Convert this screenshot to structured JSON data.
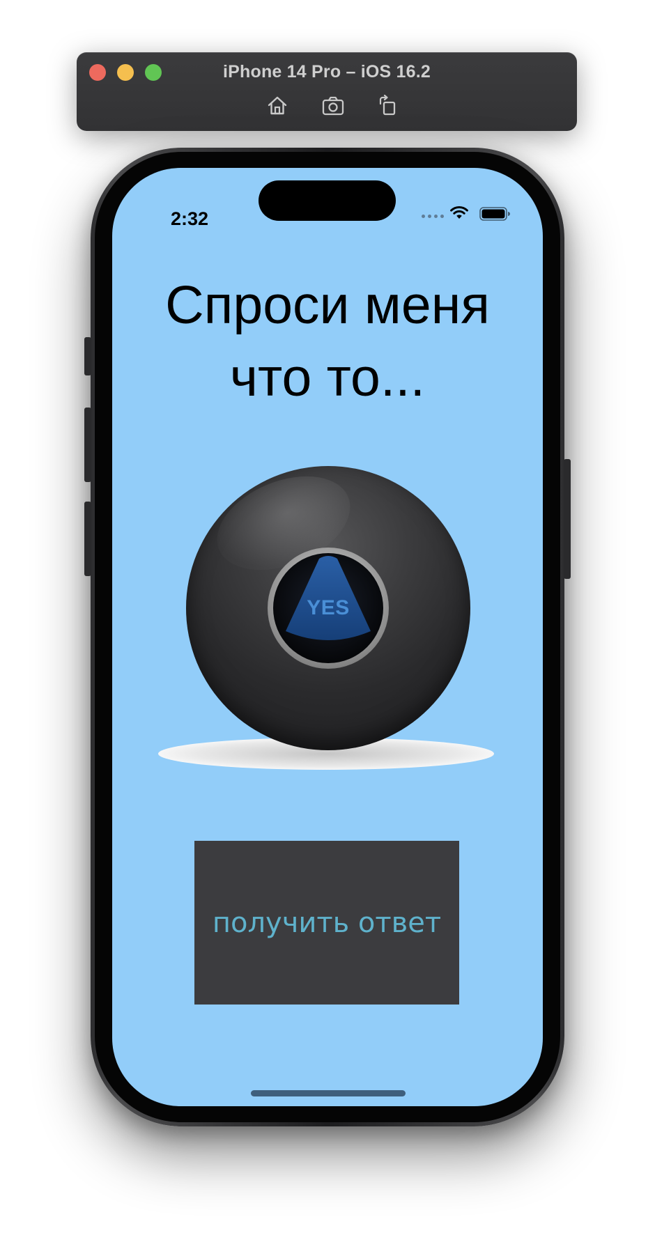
{
  "simulator": {
    "title": "iPhone 14 Pro – iOS 16.2",
    "tools": [
      "home-icon",
      "screenshot-icon",
      "rotate-icon"
    ]
  },
  "status_bar": {
    "time": "2:32"
  },
  "screen": {
    "background": "#92cdf9",
    "title_line1": "Спроси меня",
    "title_line2": "что то...",
    "ball_answer": "YES",
    "button_label": "получить ответ",
    "button_background": "#3c3c3f",
    "button_text_color": "#5fb2cc"
  }
}
